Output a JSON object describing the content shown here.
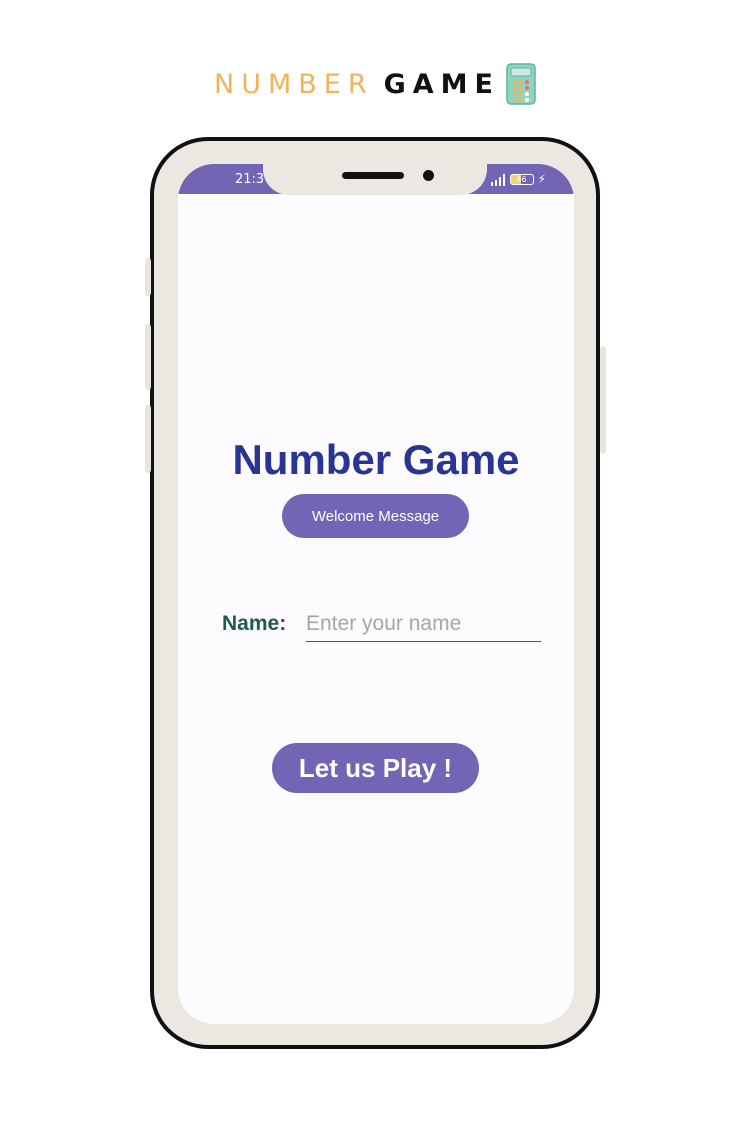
{
  "banner": {
    "word_1": "NUMBER",
    "word_2": "GAME",
    "icon": "calculator-icon"
  },
  "status_bar": {
    "time": "21:3",
    "battery_level": "46",
    "icons": [
      "signal-icon",
      "battery-icon",
      "charging-bolt-icon"
    ]
  },
  "app": {
    "title": "Number Game",
    "welcome_button_label": "Welcome Message",
    "name_label": "Name:",
    "name_input_value": "",
    "name_input_placeholder": "Enter your name",
    "play_button_label": "Let us Play !"
  },
  "colors": {
    "accent": "#7464b5",
    "title": "#283593",
    "label": "#1e5a52",
    "banner_word_1": "#f2b35a",
    "phone_frame": "#ebe8e2"
  }
}
